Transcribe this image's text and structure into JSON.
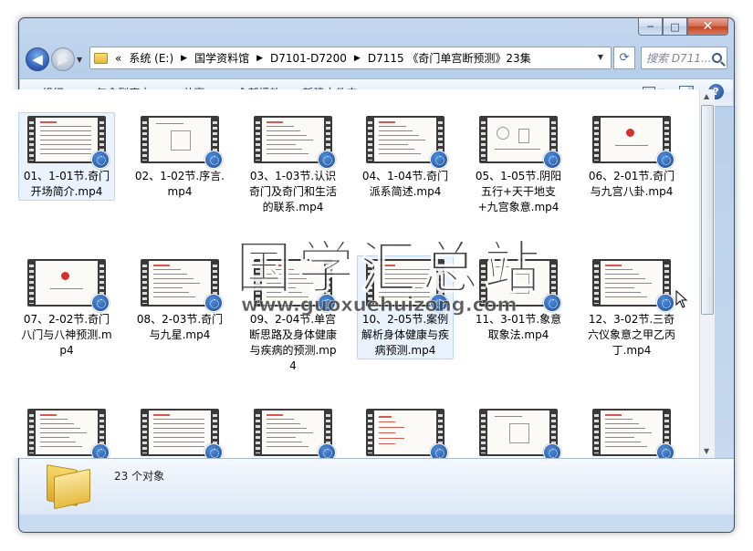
{
  "window": {
    "caption": {
      "minimize": "─",
      "maximize": "□",
      "close": "✕"
    }
  },
  "nav": {
    "back_glyph": "◀",
    "forward_glyph": "▶",
    "address": [
      "«",
      "系统 (E:)",
      "国学资料馆",
      "D7101-D7200",
      "D7115 《奇门单宫断预测》23集"
    ],
    "search_placeholder": "搜索 D711..."
  },
  "toolbar": {
    "organize": "组织",
    "include_in_library": "包含到库中",
    "share": "共享",
    "play_all": "全部播放",
    "new_folder": "新建文件夹"
  },
  "files": [
    {
      "name": "01、1-01节.奇门开场简介.mp4",
      "selected": true
    },
    {
      "name": "02、1-02节.序言.mp4"
    },
    {
      "name": "03、1-03节.认识奇门及奇门和生活的联系.mp4"
    },
    {
      "name": "04、1-04节.奇门派系简述.mp4"
    },
    {
      "name": "05、1-05节.阴阳五行+天干地支+九宫象意.mp4"
    },
    {
      "name": "06、2-01节.奇门与九宫八卦.mp4"
    },
    {
      "name": "07、2-02节.奇门八门与八神预测.mp4"
    },
    {
      "name": "08、2-03节.奇门与九星.mp4"
    },
    {
      "name": "09、2-04节.单宫断思路及身体健康与疾病的预测.mp4"
    },
    {
      "name": "10、2-05节.案例解析身体健康与疾病预测.mp4",
      "selected": true
    },
    {
      "name": "11、3-01节.象意取象法.mp4"
    },
    {
      "name": "12、3-02节.三奇六仪象意之甲乙丙丁.mp4"
    },
    {
      "name": ""
    },
    {
      "name": ""
    },
    {
      "name": ""
    },
    {
      "name": ""
    },
    {
      "name": ""
    },
    {
      "name": ""
    }
  ],
  "status": {
    "count": "23 个对象"
  },
  "watermark": {
    "title": "国学汇总站",
    "url": "www.guoxuehuizong.com"
  },
  "colors": {
    "window_frame": "#c4d7ee",
    "selection": "#eaf3fd",
    "badge": "#1d4b9c"
  }
}
